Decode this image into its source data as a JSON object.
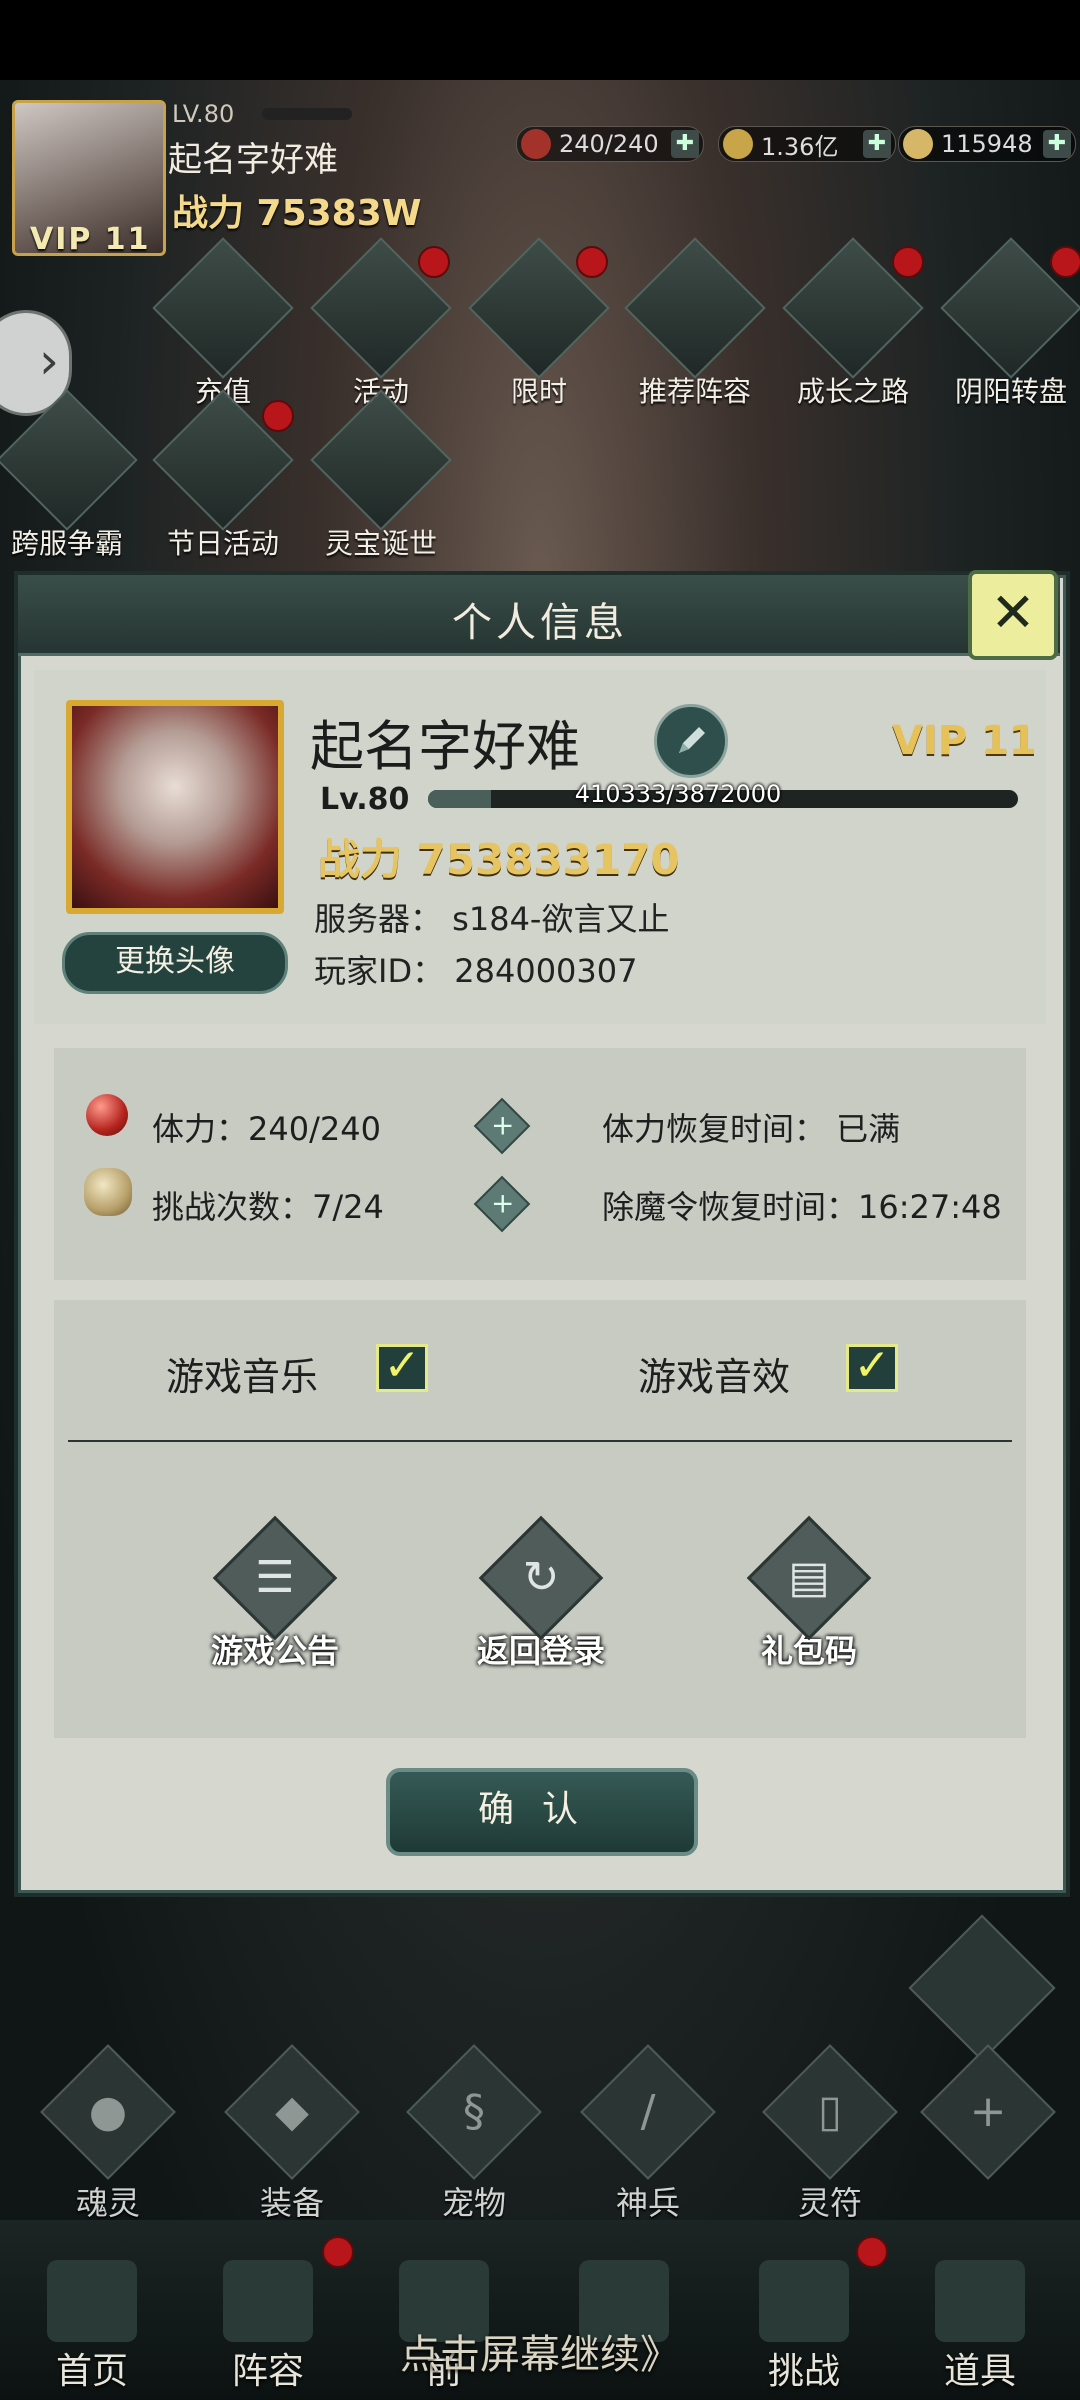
{
  "hud": {
    "level": "LV.80",
    "name": "起名字好难",
    "power": "战力 75383W",
    "vip": "VIP 11",
    "resources": [
      {
        "icon": "stamina-icon",
        "value": "240/240"
      },
      {
        "icon": "coin-icon",
        "value": "1.36亿"
      },
      {
        "icon": "ingot-icon",
        "value": "115948"
      }
    ]
  },
  "features": [
    "充值",
    "活动",
    "限时",
    "推荐阵容",
    "成长之路",
    "阴阳转盘",
    "跨服争霸",
    "节日活动",
    "灵宝诞世"
  ],
  "dialog": {
    "title": "个人信息",
    "name": "起名字好难",
    "vip": "VIP 11",
    "level": "Lv.80",
    "exp_text": "410333/3872000",
    "exp_progress": 0.106,
    "power": "战力 753833170",
    "server": "服务器：  s184-欲言又止",
    "player_id": "玩家ID：  284000307",
    "change_avatar": "更换头像",
    "stamina_label": "体力：240/240",
    "challenge_label": "挑战次数：7/24",
    "stamina_recover": "体力恢复时间：   已满",
    "token_recover": "除魔令恢复时间：16:27:48",
    "music_label": "游戏音乐",
    "sfx_label": "游戏音效",
    "music_on": true,
    "sfx_on": true,
    "actions": [
      "游戏公告",
      "返回登录",
      "礼包码"
    ],
    "confirm": "确认"
  },
  "sub_nav": [
    "魂灵",
    "装备",
    "宠物",
    "神兵",
    "灵符"
  ],
  "bottom_nav": [
    "首页",
    "阵容",
    "前",
    "",
    "挑战",
    "道具"
  ],
  "continue_text": "点击屏幕继续》"
}
